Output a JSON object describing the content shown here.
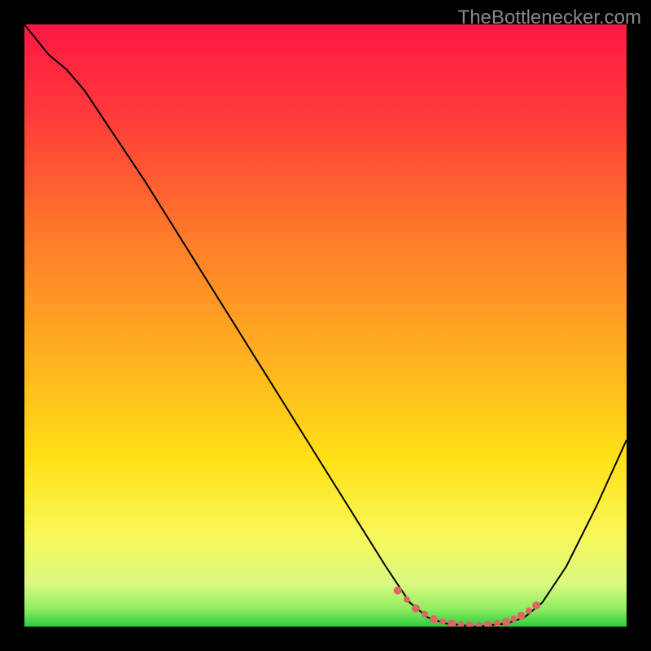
{
  "watermark": "TheBottlenecker.com",
  "chart_data": {
    "type": "line",
    "title": "",
    "xlabel": "",
    "ylabel": "",
    "xlim": [
      0,
      100
    ],
    "ylim": [
      0,
      100
    ],
    "gradient_stops": [
      {
        "offset": 0,
        "color": "#ff1744"
      },
      {
        "offset": 0.15,
        "color": "#ff3a3a"
      },
      {
        "offset": 0.35,
        "color": "#ff7a2a"
      },
      {
        "offset": 0.55,
        "color": "#ffb020"
      },
      {
        "offset": 0.72,
        "color": "#ffe015"
      },
      {
        "offset": 0.85,
        "color": "#f8f85a"
      },
      {
        "offset": 0.93,
        "color": "#d8f880"
      },
      {
        "offset": 0.97,
        "color": "#90ee60"
      },
      {
        "offset": 1.0,
        "color": "#2ecc40"
      }
    ],
    "series": [
      {
        "name": "bottleneck-curve",
        "color": "#000000",
        "width": 2,
        "points": [
          {
            "x": 0,
            "y": 100
          },
          {
            "x": 4,
            "y": 95
          },
          {
            "x": 7,
            "y": 92.5
          },
          {
            "x": 10,
            "y": 89
          },
          {
            "x": 20,
            "y": 74
          },
          {
            "x": 30,
            "y": 58
          },
          {
            "x": 40,
            "y": 42
          },
          {
            "x": 50,
            "y": 26
          },
          {
            "x": 55,
            "y": 18
          },
          {
            "x": 60,
            "y": 10
          },
          {
            "x": 64,
            "y": 4
          },
          {
            "x": 67,
            "y": 1.5
          },
          {
            "x": 70,
            "y": 0.5
          },
          {
            "x": 75,
            "y": 0
          },
          {
            "x": 80,
            "y": 0.5
          },
          {
            "x": 83,
            "y": 1.5
          },
          {
            "x": 86,
            "y": 4
          },
          {
            "x": 90,
            "y": 10
          },
          {
            "x": 95,
            "y": 20
          },
          {
            "x": 100,
            "y": 31
          }
        ]
      },
      {
        "name": "optimal-range-marker",
        "color": "#e06666",
        "type": "dotted-segment",
        "points": [
          {
            "x": 62,
            "y": 6
          },
          {
            "x": 65,
            "y": 3
          },
          {
            "x": 68,
            "y": 1.2
          },
          {
            "x": 71,
            "y": 0.5
          },
          {
            "x": 74,
            "y": 0.2
          },
          {
            "x": 77,
            "y": 0.3
          },
          {
            "x": 80,
            "y": 0.8
          },
          {
            "x": 82.5,
            "y": 1.8
          },
          {
            "x": 85,
            "y": 3.5
          }
        ]
      }
    ]
  }
}
